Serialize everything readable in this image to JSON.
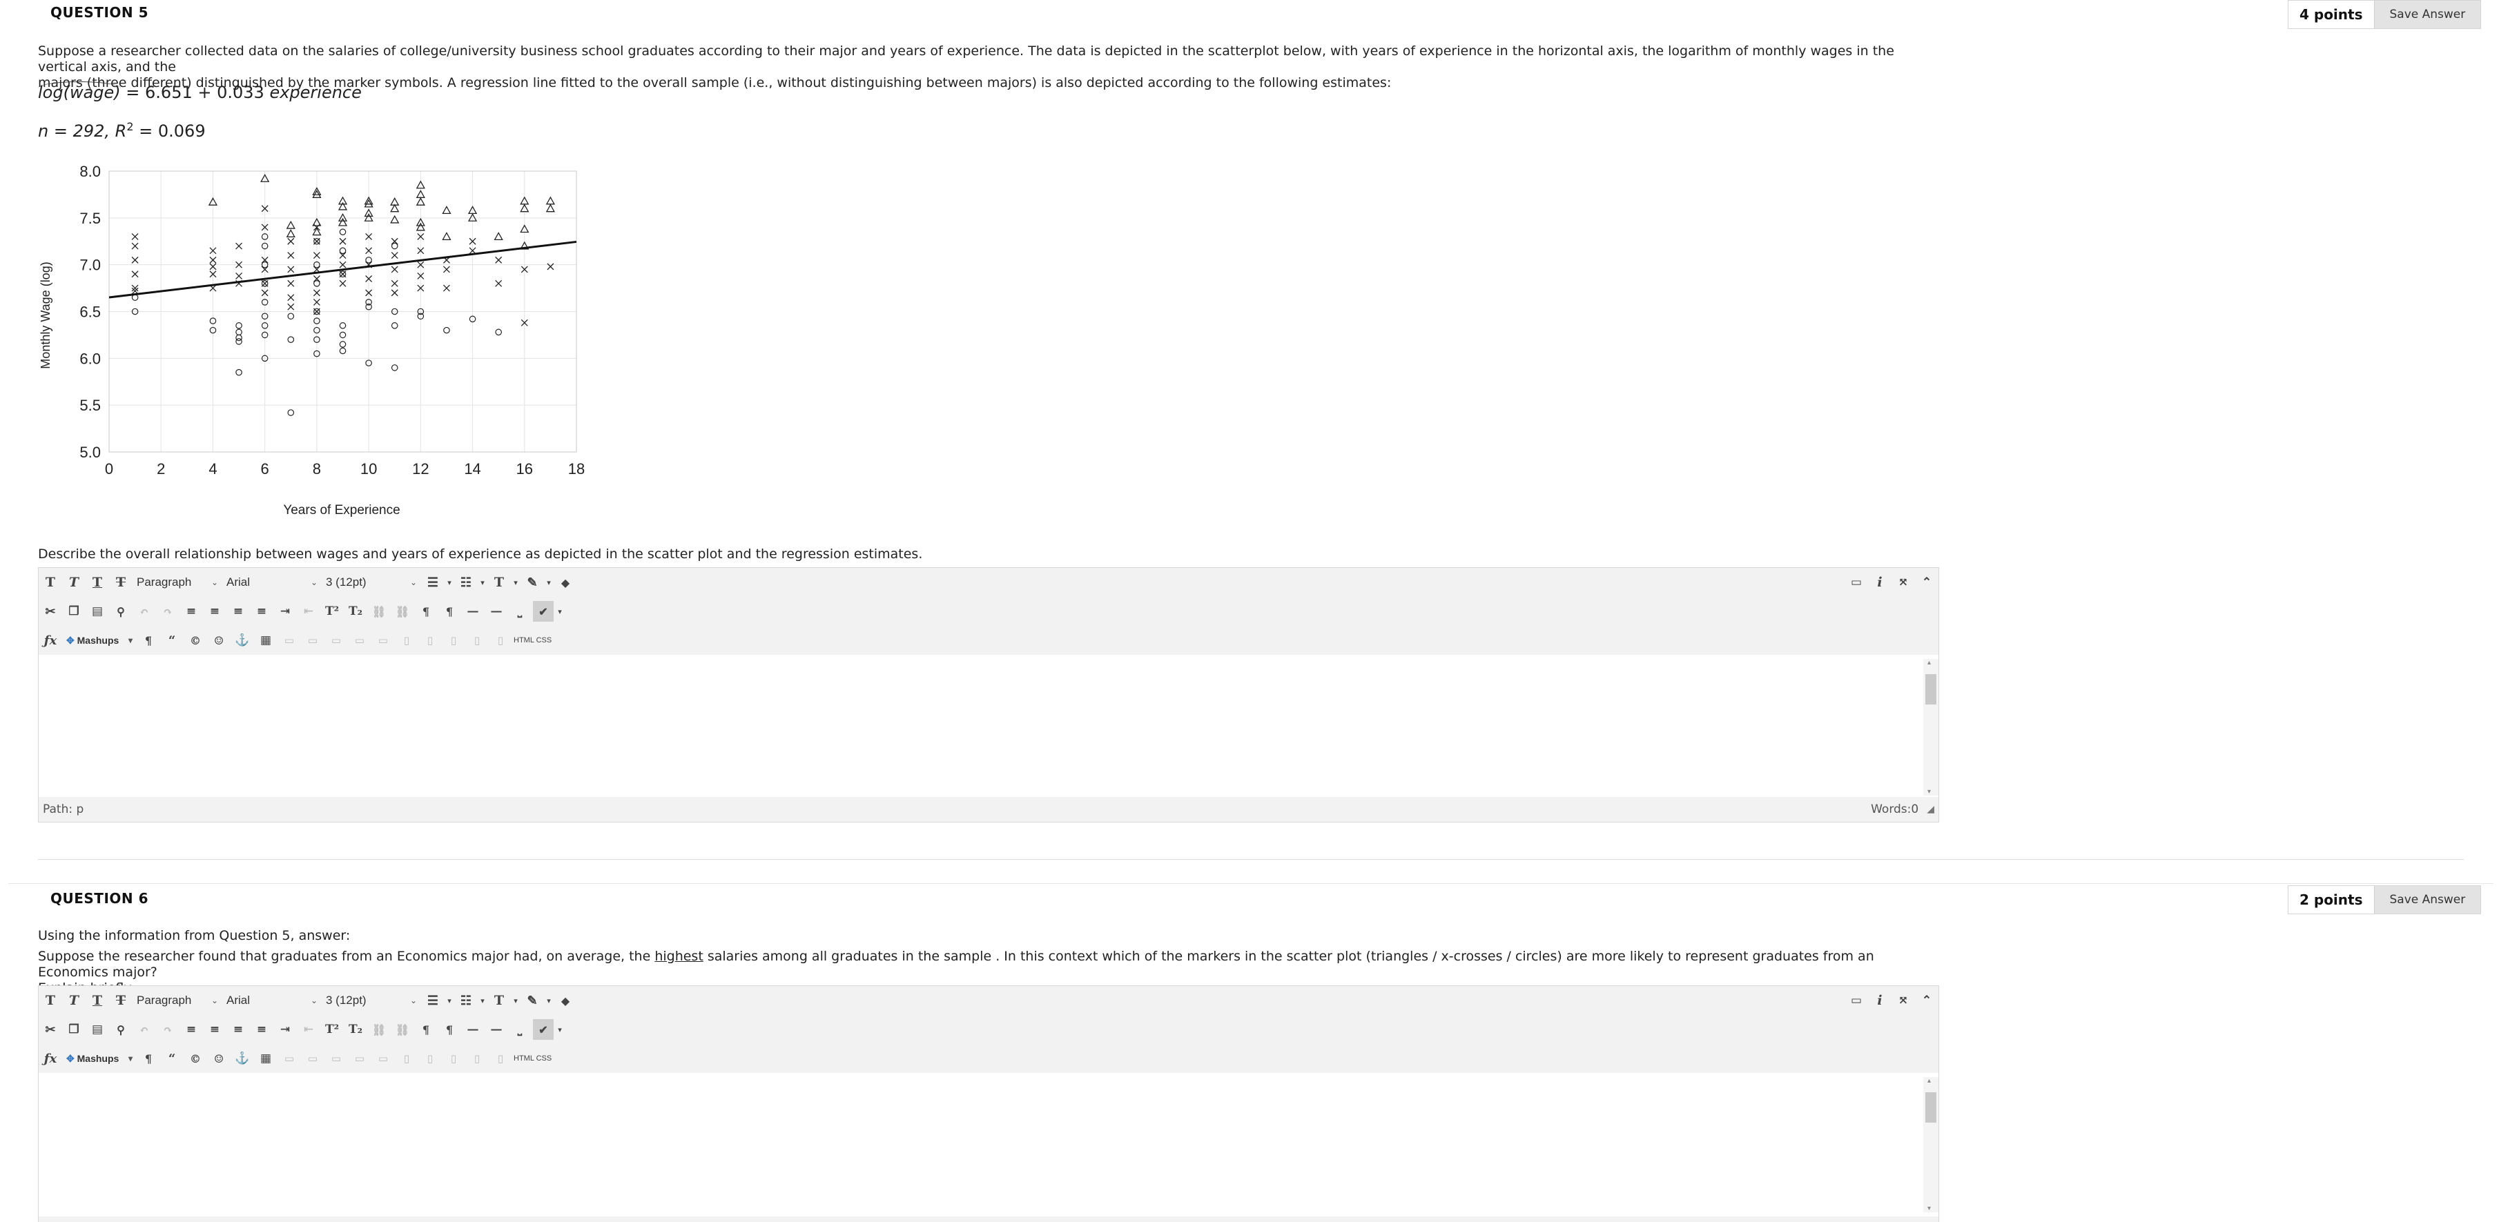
{
  "q5": {
    "title": "QUESTION 5",
    "points": "4 points",
    "save_label": "Save Answer",
    "intro_line1": "Suppose a researcher collected data on the salaries of college/university business school graduates according to their major and years of experience. The data is depicted in the scatterplot below, with years of experience in the horizontal axis, the logarithm of monthly wages in the vertical axis, and the",
    "intro_line2": "majors (three different) distinguished by the marker symbols. A regression line fitted to the overall sample (i.e., without distinguishing between majors) is also depicted according to the following estimates:",
    "formula_lhs": "log(wage)",
    "formula_rhs": " = 6.651 + 0.033 ",
    "formula_var": "experience",
    "stats_n": "n = 292,  R",
    "stats_sup": "2",
    "stats_r2": " = 0.069",
    "prompt": "Describe the overall relationship between wages and years of experience as depicted in the scatter plot and the regression estimates.",
    "path_label": "Path: p",
    "words_label": "Words:0"
  },
  "q6": {
    "title": "QUESTION 6",
    "points": "2 points",
    "save_label": "Save Answer",
    "line1": "Using the information from Question 5, answer:",
    "line2a": "Suppose the researcher found that graduates from an Economics major had, on average, the ",
    "line2_underlined": "highest",
    "line2b": " salaries among all graduates in the sample . In this context which of the markers in the scatter plot (triangles / x-crosses / circles) are more likely to represent graduates from an Economics major?",
    "line3": "Explain briefly."
  },
  "toolbar": {
    "paragraph": "Paragraph",
    "font": "Arial",
    "size": "3 (12pt)",
    "mashups": "Mashups",
    "html_css": "HTML CSS"
  },
  "chart_data": {
    "type": "scatter",
    "xlabel": "Years of Experience",
    "ylabel": "Monthly Wage (log)",
    "xlim": [
      0,
      18
    ],
    "ylim": [
      5.0,
      8.0
    ],
    "xticks": [
      "0",
      "2",
      "4",
      "6",
      "8",
      "10",
      "12",
      "14",
      "16",
      "18"
    ],
    "yticks": [
      "8.0",
      "7.5",
      "7.0",
      "6.5",
      "6.0",
      "5.5",
      "5.0"
    ],
    "grid": true,
    "regression": {
      "intercept": 6.651,
      "slope": 0.033
    },
    "series": [
      {
        "marker": "triangle",
        "points": [
          [
            4,
            7.67
          ],
          [
            6,
            7.92
          ],
          [
            7,
            7.42
          ],
          [
            7,
            7.33
          ],
          [
            8,
            7.78
          ],
          [
            8,
            7.75
          ],
          [
            8,
            7.45
          ],
          [
            8,
            7.35
          ],
          [
            9,
            7.68
          ],
          [
            9,
            7.62
          ],
          [
            9,
            7.5
          ],
          [
            9,
            7.45
          ],
          [
            10,
            7.68
          ],
          [
            10,
            7.65
          ],
          [
            10,
            7.55
          ],
          [
            10,
            7.5
          ],
          [
            11,
            7.67
          ],
          [
            11,
            7.6
          ],
          [
            11,
            7.48
          ],
          [
            12,
            7.85
          ],
          [
            12,
            7.75
          ],
          [
            12,
            7.67
          ],
          [
            12,
            7.45
          ],
          [
            12,
            7.4
          ],
          [
            13,
            7.58
          ],
          [
            13,
            7.3
          ],
          [
            14,
            7.58
          ],
          [
            14,
            7.5
          ],
          [
            15,
            7.3
          ],
          [
            16,
            7.68
          ],
          [
            16,
            7.6
          ],
          [
            16,
            7.38
          ],
          [
            16,
            7.2
          ],
          [
            17,
            7.68
          ],
          [
            17,
            7.6
          ]
        ]
      },
      {
        "marker": "x",
        "points": [
          [
            1,
            7.3
          ],
          [
            1,
            7.2
          ],
          [
            1,
            7.05
          ],
          [
            1,
            6.9
          ],
          [
            1,
            6.75
          ],
          [
            1,
            6.72
          ],
          [
            4,
            7.15
          ],
          [
            4,
            7.05
          ],
          [
            4,
            6.98
          ],
          [
            4,
            6.9
          ],
          [
            4,
            6.75
          ],
          [
            5,
            7.2
          ],
          [
            5,
            7.0
          ],
          [
            5,
            6.88
          ],
          [
            5,
            6.8
          ],
          [
            6,
            7.6
          ],
          [
            6,
            7.4
          ],
          [
            6,
            7.05
          ],
          [
            6,
            6.95
          ],
          [
            6,
            6.8
          ],
          [
            6,
            6.7
          ],
          [
            7,
            7.25
          ],
          [
            7,
            7.1
          ],
          [
            7,
            6.95
          ],
          [
            7,
            6.8
          ],
          [
            7,
            6.65
          ],
          [
            7,
            6.55
          ],
          [
            8,
            7.4
          ],
          [
            8,
            7.25
          ],
          [
            8,
            7.1
          ],
          [
            8,
            6.95
          ],
          [
            8,
            6.85
          ],
          [
            8,
            6.7
          ],
          [
            8,
            6.6
          ],
          [
            8,
            6.5
          ],
          [
            9,
            7.25
          ],
          [
            9,
            7.1
          ],
          [
            9,
            7.0
          ],
          [
            9,
            6.9
          ],
          [
            9,
            6.8
          ],
          [
            10,
            7.3
          ],
          [
            10,
            7.15
          ],
          [
            10,
            7.0
          ],
          [
            10,
            6.85
          ],
          [
            10,
            6.7
          ],
          [
            11,
            7.25
          ],
          [
            11,
            7.1
          ],
          [
            11,
            6.95
          ],
          [
            11,
            6.8
          ],
          [
            11,
            6.7
          ],
          [
            12,
            7.3
          ],
          [
            12,
            7.15
          ],
          [
            12,
            7.0
          ],
          [
            12,
            6.88
          ],
          [
            12,
            6.75
          ],
          [
            13,
            7.05
          ],
          [
            13,
            6.95
          ],
          [
            13,
            6.75
          ],
          [
            14,
            7.25
          ],
          [
            14,
            7.15
          ],
          [
            15,
            7.05
          ],
          [
            15,
            6.8
          ],
          [
            16,
            6.95
          ],
          [
            16,
            6.38
          ],
          [
            17,
            6.98
          ]
        ]
      },
      {
        "marker": "circle",
        "points": [
          [
            1,
            6.65
          ],
          [
            1,
            6.5
          ],
          [
            4,
            6.4
          ],
          [
            4,
            6.3
          ],
          [
            5,
            6.35
          ],
          [
            5,
            6.28
          ],
          [
            5,
            6.22
          ],
          [
            5,
            6.18
          ],
          [
            5,
            5.85
          ],
          [
            6,
            7.3
          ],
          [
            6,
            7.2
          ],
          [
            6,
            7.0
          ],
          [
            6,
            6.8
          ],
          [
            6,
            6.6
          ],
          [
            6,
            6.45
          ],
          [
            6,
            6.35
          ],
          [
            6,
            6.25
          ],
          [
            6,
            6.0
          ],
          [
            7,
            6.45
          ],
          [
            7,
            6.2
          ],
          [
            7,
            5.42
          ],
          [
            8,
            7.25
          ],
          [
            8,
            7.0
          ],
          [
            8,
            6.8
          ],
          [
            8,
            6.5
          ],
          [
            8,
            6.4
          ],
          [
            8,
            6.3
          ],
          [
            8,
            6.2
          ],
          [
            8,
            6.05
          ],
          [
            9,
            7.35
          ],
          [
            9,
            7.15
          ],
          [
            9,
            6.9
          ],
          [
            9,
            6.35
          ],
          [
            9,
            6.25
          ],
          [
            9,
            6.15
          ],
          [
            9,
            6.08
          ],
          [
            10,
            7.05
          ],
          [
            10,
            6.6
          ],
          [
            10,
            6.55
          ],
          [
            10,
            5.95
          ],
          [
            11,
            7.2
          ],
          [
            11,
            6.5
          ],
          [
            11,
            6.35
          ],
          [
            11,
            5.9
          ],
          [
            12,
            6.5
          ],
          [
            12,
            6.45
          ],
          [
            13,
            6.3
          ],
          [
            14,
            6.42
          ],
          [
            15,
            6.28
          ]
        ]
      }
    ]
  }
}
